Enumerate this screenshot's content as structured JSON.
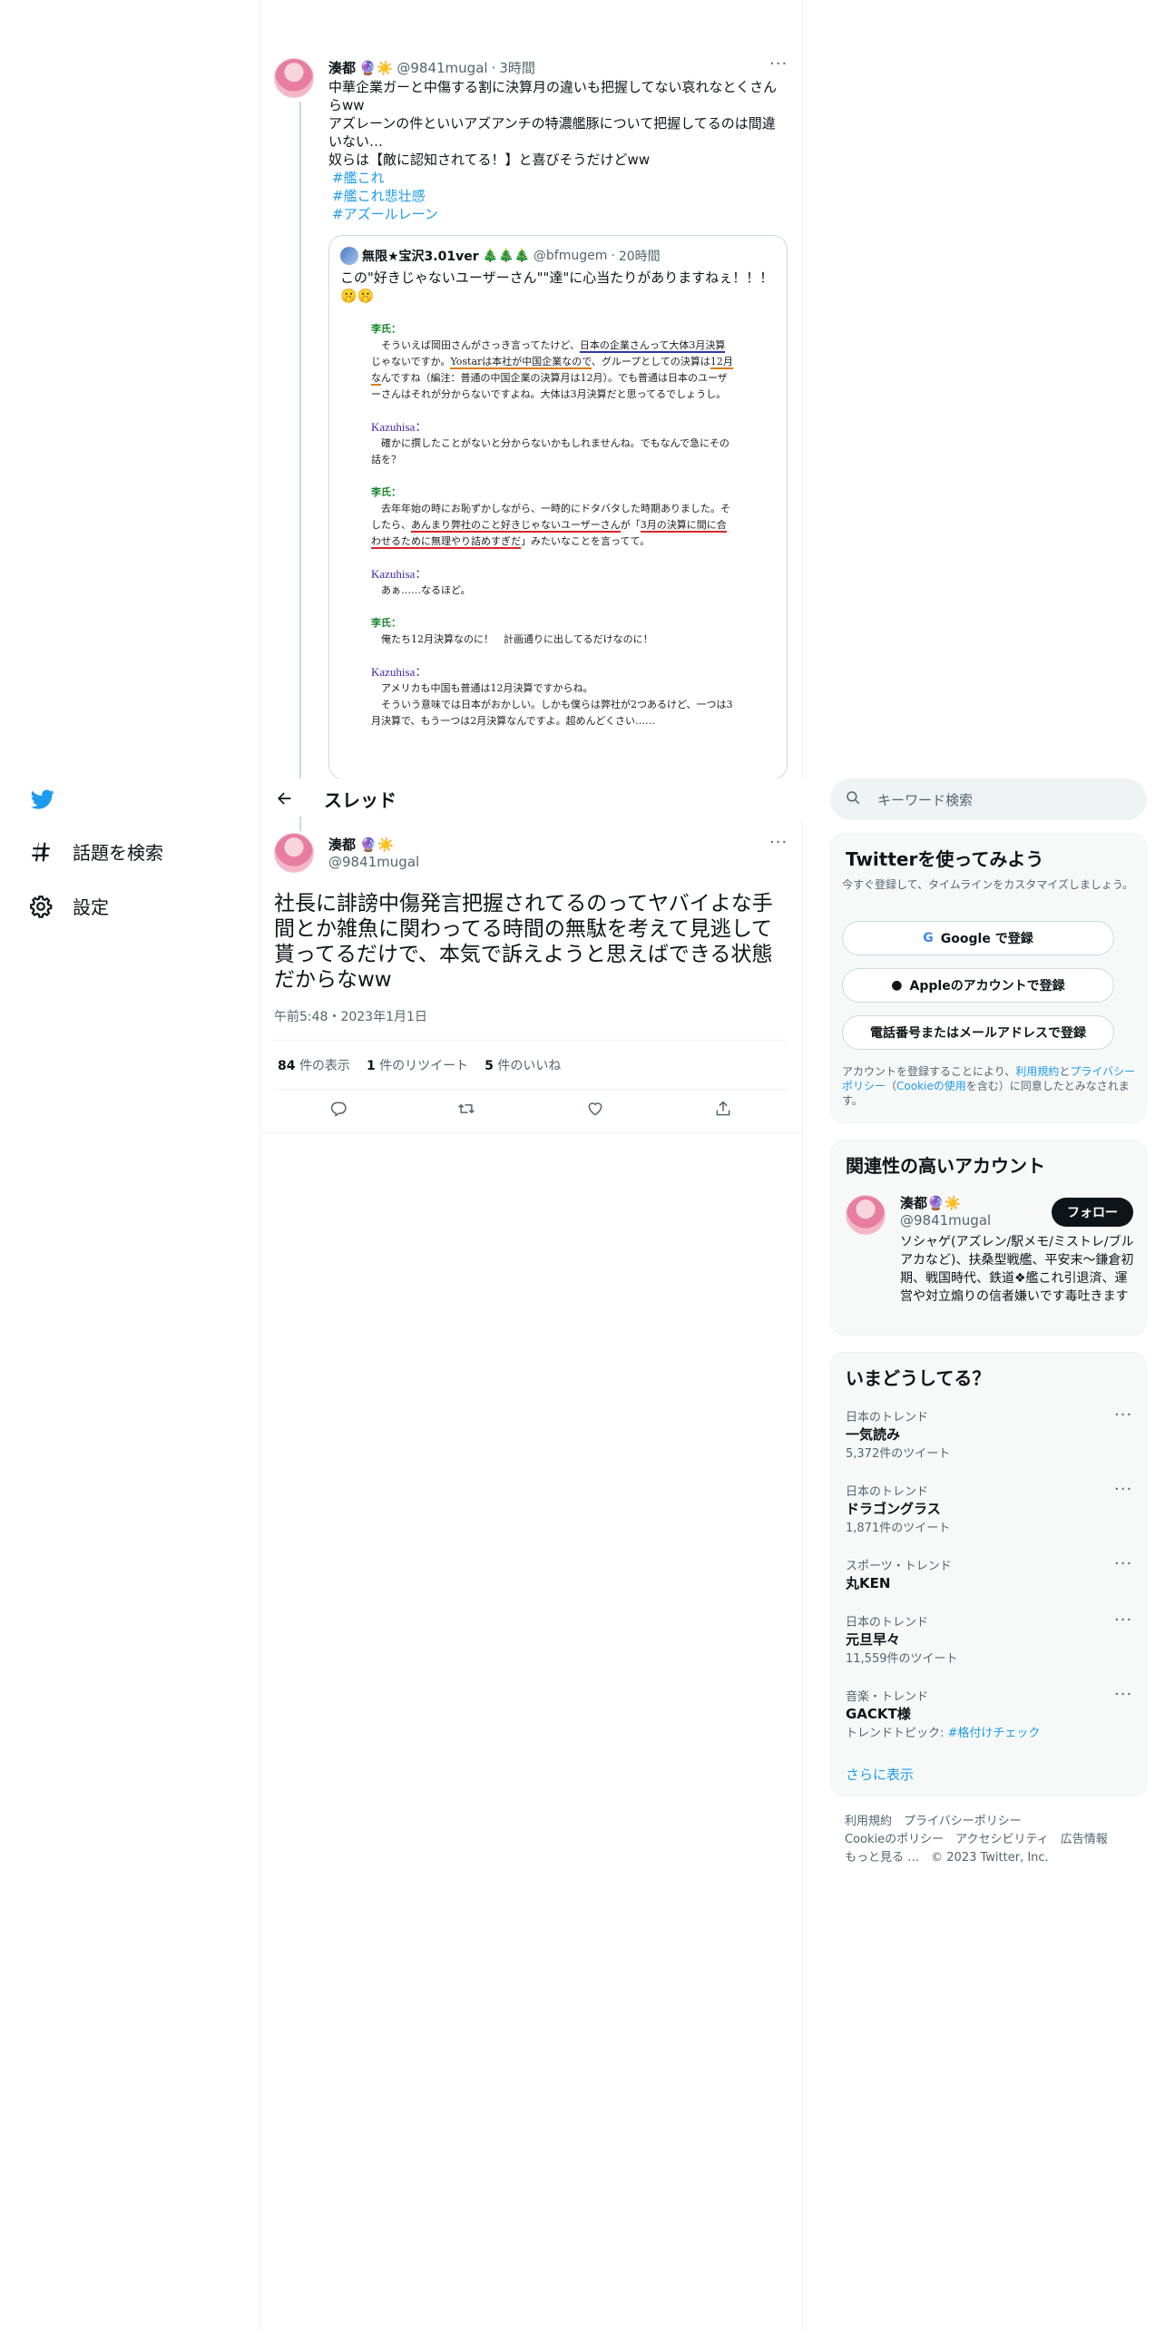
{
  "quoted_thread": {
    "author_name": "湊都",
    "author_emoji": "🔮☀️",
    "author_handle": "@9841mugal",
    "time": "3時間",
    "text_lines": [
      "中華企業ガーと中傷する割に決算月の違いも把握してない哀れなとくさんらww",
      "アズレーンの件といいアズアンチの特濃艦豚について把握してるのは間違いない…",
      "奴らは【敵に認知されてる！】と喜びそうだけどww"
    ],
    "hashtags": [
      "#艦これ",
      "#艦これ悲壮感",
      "#アズールレーン"
    ],
    "quote": {
      "author_name": "無限★宝沢3.01ver",
      "author_emoji": "🎄🎄🎄",
      "author_handle": "@bfmugem",
      "time": "20時間",
      "text": "この\"好きじゃないユーザーさん\"\"達\"に心当たりがありますねぇ！！！",
      "text_emoji": "🤫🤫",
      "image": {
        "speaker_li": "李氏：",
        "speaker_kaz": "Kazuhisa：",
        "p1_a": "　そういえば岡田さんがさっき言ってたけど、",
        "p1_u1": "日本の企業さんって大体3月決算",
        "p1_b": "じゃないですか。",
        "p1_u2": "Yostarは本社が中国企業なので",
        "p1_c": "、グループとしての決算は",
        "p1_u3": "12月な",
        "p1_d": "んですね（編注：普通の中国企業の決算月は12月）。でも普通は日本のユーザーさんはそれが分からないですよね。大体は3月決算だと思ってるでしょうし。",
        "p2": "　確かに撰したことがないと分からないかもしれませんね。でもなんで急にその話を？",
        "p3_a": "　去年年始の時にお恥ずかしながら、一時的にドタバタした時期ありました。そしたら、",
        "p3_u1": "あんまり弊社のこと好きじゃないユーザーさん",
        "p3_b": "が「",
        "p3_u2": "3月の決算に間に合わせるために無理やり詰めすぎだ",
        "p3_c": "」みたいなことを言ってて。",
        "p4": "　あぁ……なるほど。",
        "p5": "　俺たち12月決算なのに！　計画通りに出してるだけなのに！",
        "p6_a": "　アメリカも中国も普通は12月決算ですからね。",
        "p6_b": "　そういう意味では日本がおかしい。しかも僕らは弊社が2つあるけど、一つは3月決算で、もう一つは2月決算なんですよ。超めんどくさい……"
      }
    }
  },
  "nav": {
    "explore_label": "話題を検索",
    "settings_label": "設定"
  },
  "header": {
    "title": "スレッド"
  },
  "main_tweet": {
    "author_name": "湊都",
    "author_emoji": "🔮☀️",
    "author_handle": "@9841mugal",
    "text": "社長に誹謗中傷発言把握されてるのってヤバイよな手間とか雑魚に関わってる時間の無駄を考えて見逃して貰ってるだけで、本気で訴えようと思えばできる状態だからなww",
    "timestamp": "午前5:48・2023年1月1日",
    "views_count": "84",
    "views_label": "件の表示",
    "retweets_count": "1",
    "retweets_label": "件のリツイート",
    "likes_count": "5",
    "likes_label": "件のいいね"
  },
  "search": {
    "placeholder": "キーワード検索"
  },
  "signup": {
    "title": "Twitterを使ってみよう",
    "subtitle": "今すぐ登録して、タイムラインをカスタマイズしましょう。",
    "google_label": "Google で登録",
    "apple_label": "Appleのアカウントで登録",
    "phone_label": "電話番号またはメールアドレスで登録",
    "legal_a": "アカウントを登録することにより、",
    "legal_terms": "利用規約",
    "legal_b": "と",
    "legal_privacy": "プライバシーポリシー",
    "legal_c": "（",
    "legal_cookie": "Cookieの使用",
    "legal_d": "を含む）に同意したとみなされます。"
  },
  "related": {
    "title": "関連性の高いアカウント",
    "name": "湊都",
    "emoji": "🔮☀️",
    "handle": "@9841mugal",
    "follow_label": "フォロー",
    "bio": "ソシャゲ(アズレン/駅メモ/ミストレ/ブルアカなど)、扶桑型戦艦、平安末～鎌倉初期、戦国時代、鉄道❖艦これ引退済、運営や対立煽りの信者嫌いです毒吐きます"
  },
  "trends": {
    "title": "いまどうしてる？",
    "items": [
      {
        "category": "日本のトレンド",
        "name": "一気読み",
        "count": "5,372件のツイート"
      },
      {
        "category": "日本のトレンド",
        "name": "ドラゴングラス",
        "count": "1,871件のツイート"
      },
      {
        "category": "スポーツ・トレンド",
        "name": "丸KEN",
        "count": ""
      },
      {
        "category": "日本のトレンド",
        "name": "元旦早々",
        "count": "11,559件のツイート"
      },
      {
        "category": "音楽・トレンド",
        "name": "GACKT様",
        "count": "トレンドトピック: ",
        "topic": "#格付けチェック"
      }
    ],
    "show_more": "さらに表示"
  },
  "footer": {
    "terms": "利用規約",
    "privacy": "プライバシーポリシー",
    "cookie": "Cookieのポリシー",
    "accessibility": "アクセシビリティ",
    "ads": "広告情報",
    "more": "もっと見る …",
    "copyright": "© 2023 Twitter, Inc."
  },
  "colors": {
    "accent": "#1d9bf0",
    "text": "#0f1419",
    "muted": "#536471"
  }
}
